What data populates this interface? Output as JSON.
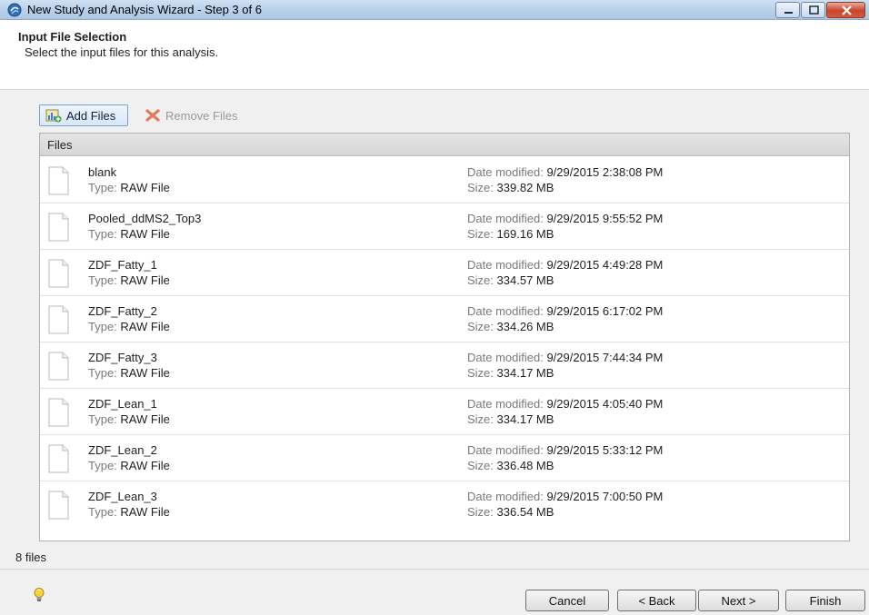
{
  "window": {
    "title": "New Study and Analysis Wizard - Step 3 of 6"
  },
  "header": {
    "title": "Input File Selection",
    "subtitle": "Select the input files for this analysis."
  },
  "toolbar": {
    "add_label": "Add Files",
    "remove_label": "Remove Files"
  },
  "files": {
    "column_header": "Files",
    "type_label": "Type:",
    "date_label": "Date modified:",
    "size_label": "Size:",
    "items": [
      {
        "name": "blank",
        "type": "RAW File",
        "date": "9/29/2015 2:38:08 PM",
        "size": "339.82 MB"
      },
      {
        "name": "Pooled_ddMS2_Top3",
        "type": "RAW File",
        "date": "9/29/2015 9:55:52 PM",
        "size": "169.16 MB"
      },
      {
        "name": "ZDF_Fatty_1",
        "type": "RAW File",
        "date": "9/29/2015 4:49:28 PM",
        "size": "334.57 MB"
      },
      {
        "name": "ZDF_Fatty_2",
        "type": "RAW File",
        "date": "9/29/2015 6:17:02 PM",
        "size": "334.26 MB"
      },
      {
        "name": "ZDF_Fatty_3",
        "type": "RAW File",
        "date": "9/29/2015 7:44:34 PM",
        "size": "334.17 MB"
      },
      {
        "name": "ZDF_Lean_1",
        "type": "RAW File",
        "date": "9/29/2015 4:05:40 PM",
        "size": "334.17 MB"
      },
      {
        "name": "ZDF_Lean_2",
        "type": "RAW File",
        "date": "9/29/2015 5:33:12 PM",
        "size": "336.48 MB"
      },
      {
        "name": "ZDF_Lean_3",
        "type": "RAW File",
        "date": "9/29/2015 7:00:50 PM",
        "size": "336.54 MB"
      }
    ],
    "count_text": "8 files"
  },
  "footer": {
    "cancel_label": "Cancel",
    "back_label": "< Back",
    "next_label": "Next >",
    "finish_label": "Finish"
  },
  "icons": {
    "app": "app-logo-icon",
    "add": "add-files-icon",
    "remove": "remove-files-icon",
    "file": "document-icon",
    "hint": "lightbulb-icon"
  }
}
